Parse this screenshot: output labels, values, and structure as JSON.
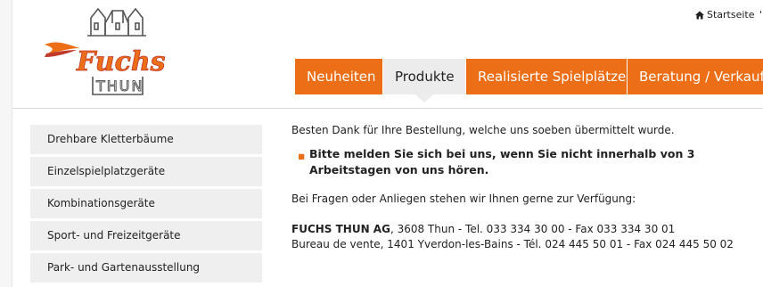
{
  "logo": {
    "wordmark": "Fuchs",
    "subtext": "THUN",
    "colors": {
      "orange": "#ec6e16",
      "red": "#c0392b",
      "outline": "#555555"
    }
  },
  "top_links": {
    "home": "Startseite",
    "cutoff": "'"
  },
  "nav": {
    "items": [
      {
        "label": "Neuheiten"
      },
      {
        "label": "Produkte"
      },
      {
        "label": "Realisierte Spielplätze"
      },
      {
        "label": "Beratung / Verkauf"
      }
    ],
    "active_index": 1,
    "accent_color": "#ec6e16"
  },
  "sidebar": {
    "items": [
      {
        "label": "Drehbare Kletterbäume"
      },
      {
        "label": "Einzelspielplatzgeräte"
      },
      {
        "label": "Kombinationsgeräte"
      },
      {
        "label": "Sport- und Freizeitgeräte"
      },
      {
        "label": "Park- und Gartenausstellung"
      }
    ]
  },
  "content": {
    "thanks": "Besten Dank für Ihre Bestellung, welche uns soeben übermittelt wurde.",
    "bullet": "Bitte melden Sie sich bei uns, wenn Sie nicht innerhalb von 3 Arbeitstagen von uns hören.",
    "questions": "Bei Fragen oder Anliegen stehen wir Ihnen gerne zur Verfügung:",
    "address": {
      "company": "FUCHS THUN AG",
      "line1_rest": ", 3608 Thun - Tel. 033 334 30 00 - Fax 033 334 30 01",
      "line2": "Bureau de vente, 1401 Yverdon-les-Bains - Tél. 024 445 50 01 - Fax 024 445 50 02"
    }
  }
}
